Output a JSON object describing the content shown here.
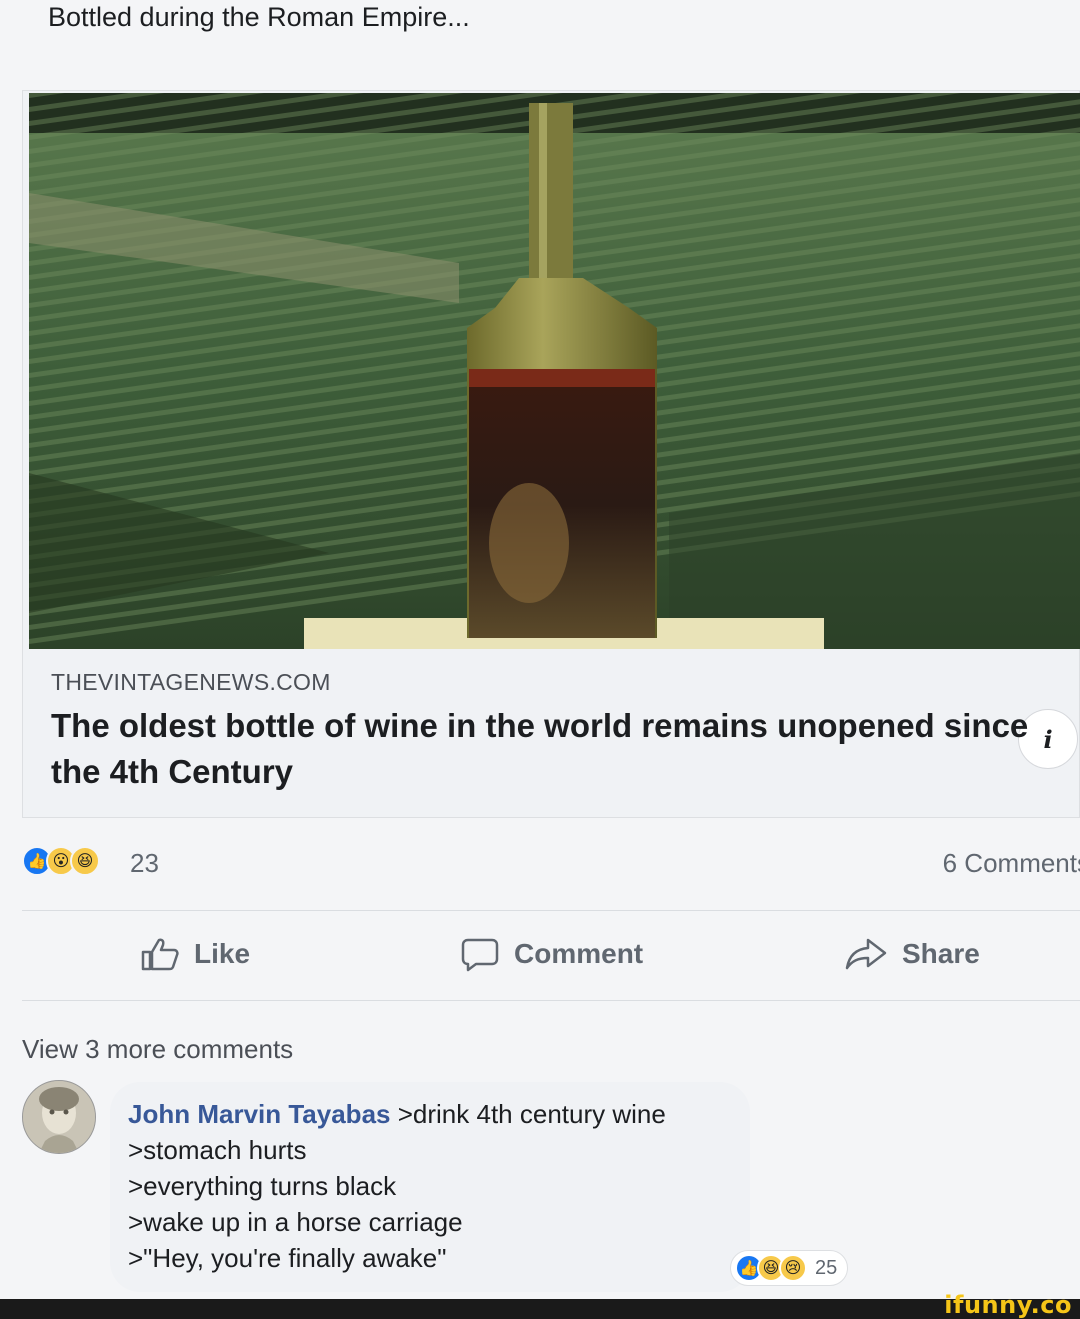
{
  "post": {
    "text": "Bottled during the Roman Empire..."
  },
  "link": {
    "image_alt": "Ancient glass wine bottle in front of a vineyard",
    "domain": "THEVINTAGENEWS.COM",
    "title": "The oldest bottle of wine in the world remains unopened since the 4th Century",
    "info_icon": "i"
  },
  "stats": {
    "reactions": [
      "like",
      "wow",
      "haha"
    ],
    "reaction_count": "23",
    "comments_label": "6 Comments"
  },
  "actions": {
    "like": "Like",
    "comment": "Comment",
    "share": "Share"
  },
  "comments": {
    "view_more": "View 3 more comments",
    "items": [
      {
        "author": "John Marvin Tayabas",
        "text": " >drink 4th century wine\n>stomach hurts\n>everything turns black\n>wake up in a horse carriage\n>\"Hey, you're finally awake\"",
        "reactions": [
          "like",
          "haha",
          "sad"
        ],
        "reaction_count": "25"
      }
    ]
  },
  "watermark": "ifunny.co",
  "colors": {
    "link_blue": "#385898",
    "like_blue": "#1877f2",
    "emoji_yellow": "#f7c94a",
    "watermark_yellow": "#f5c518"
  }
}
